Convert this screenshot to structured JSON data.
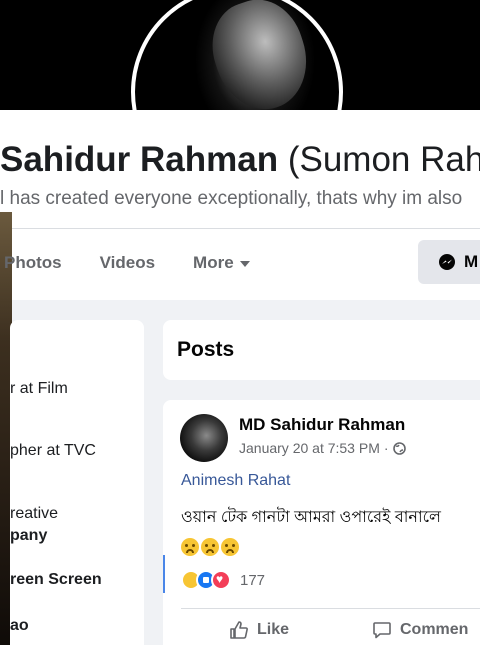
{
  "profile": {
    "name": "Sahidur Rahman",
    "alt_name": "(Sumon Rahr",
    "bio": "l has created everyone exceptionally, thats why im also"
  },
  "tabs": [
    "Photos",
    "Videos",
    "More"
  ],
  "message_button": "M",
  "intro": [
    {
      "text": "r at Film",
      "bold": false
    },
    {
      "text": "pher at TVC",
      "bold": false
    },
    {
      "text": "reative",
      "bold": false
    },
    {
      "text": "pany",
      "bold": true
    },
    {
      "text": "reen Screen",
      "bold": true
    },
    {
      "text": "ao",
      "bold": true
    }
  ],
  "posts_section": {
    "title": "Posts"
  },
  "post": {
    "author": "MD Sahidur Rahman",
    "date": "January 20 at 7:53 PM",
    "dot": "·",
    "mention": "Animesh Rahat",
    "text": "ওয়ান টেক গানটা আমরা ওপারেই বানালে",
    "reaction_count": "177",
    "like_label": "Like",
    "comment_label": "Commen"
  },
  "icons": [
    "messenger-icon",
    "globe-icon",
    "like-icon",
    "comment-icon",
    "caret-down-icon"
  ],
  "colors": {
    "link": "#385898",
    "like_blue": "#1877f2",
    "love_red": "#f33e58",
    "sad_yellow": "#f7c533"
  }
}
